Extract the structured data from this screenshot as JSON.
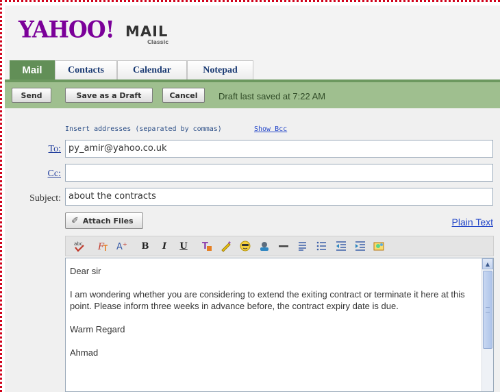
{
  "logo": {
    "brand": "YAHOO!",
    "product": "MAIL",
    "edition": "Classic"
  },
  "tabs": [
    {
      "label": "Mail",
      "active": true
    },
    {
      "label": "Contacts"
    },
    {
      "label": "Calendar"
    },
    {
      "label": "Notepad"
    }
  ],
  "toolbar": {
    "send_label": "Send",
    "save_draft_label": "Save as a Draft",
    "cancel_label": "Cancel",
    "draft_status": "Draft last saved at 7:22 AM"
  },
  "compose": {
    "insert_hint": "Insert addresses (separated by commas)",
    "show_bcc": "Show Bcc",
    "to_label": "To:",
    "cc_label": "Cc:",
    "subject_label": "Subject:",
    "to_value": "py_amir@yahoo.co.uk",
    "cc_value": "",
    "subject_value": "about the contracts",
    "attach_label": "Attach Files",
    "plain_text_link": "Plain Text"
  },
  "body": {
    "line1": "Dear sir",
    "line2": "I am wondering whether you are considering to extend the exiting contract or terminate it here at this point. Please inform three weeks in advance before, the contract expiry date is due.",
    "line3": "Warm Regard",
    "line4": "Ahmad"
  },
  "format_toolbar": [
    "spellcheck-icon",
    "font-icon",
    "font-size-icon",
    "bold-icon",
    "italic-icon",
    "underline-icon",
    "text-color-icon",
    "highlight-icon",
    "emoticon-icon",
    "insert-image-icon",
    "horizontal-rule-icon",
    "numbered-list-icon",
    "bulleted-list-icon",
    "outdent-icon",
    "indent-icon",
    "stationery-icon"
  ],
  "colors": {
    "brand_purple": "#7b0099",
    "tab_green": "#628f57",
    "toolbar_green": "#9fbf8f",
    "link_blue": "#2447c9"
  }
}
